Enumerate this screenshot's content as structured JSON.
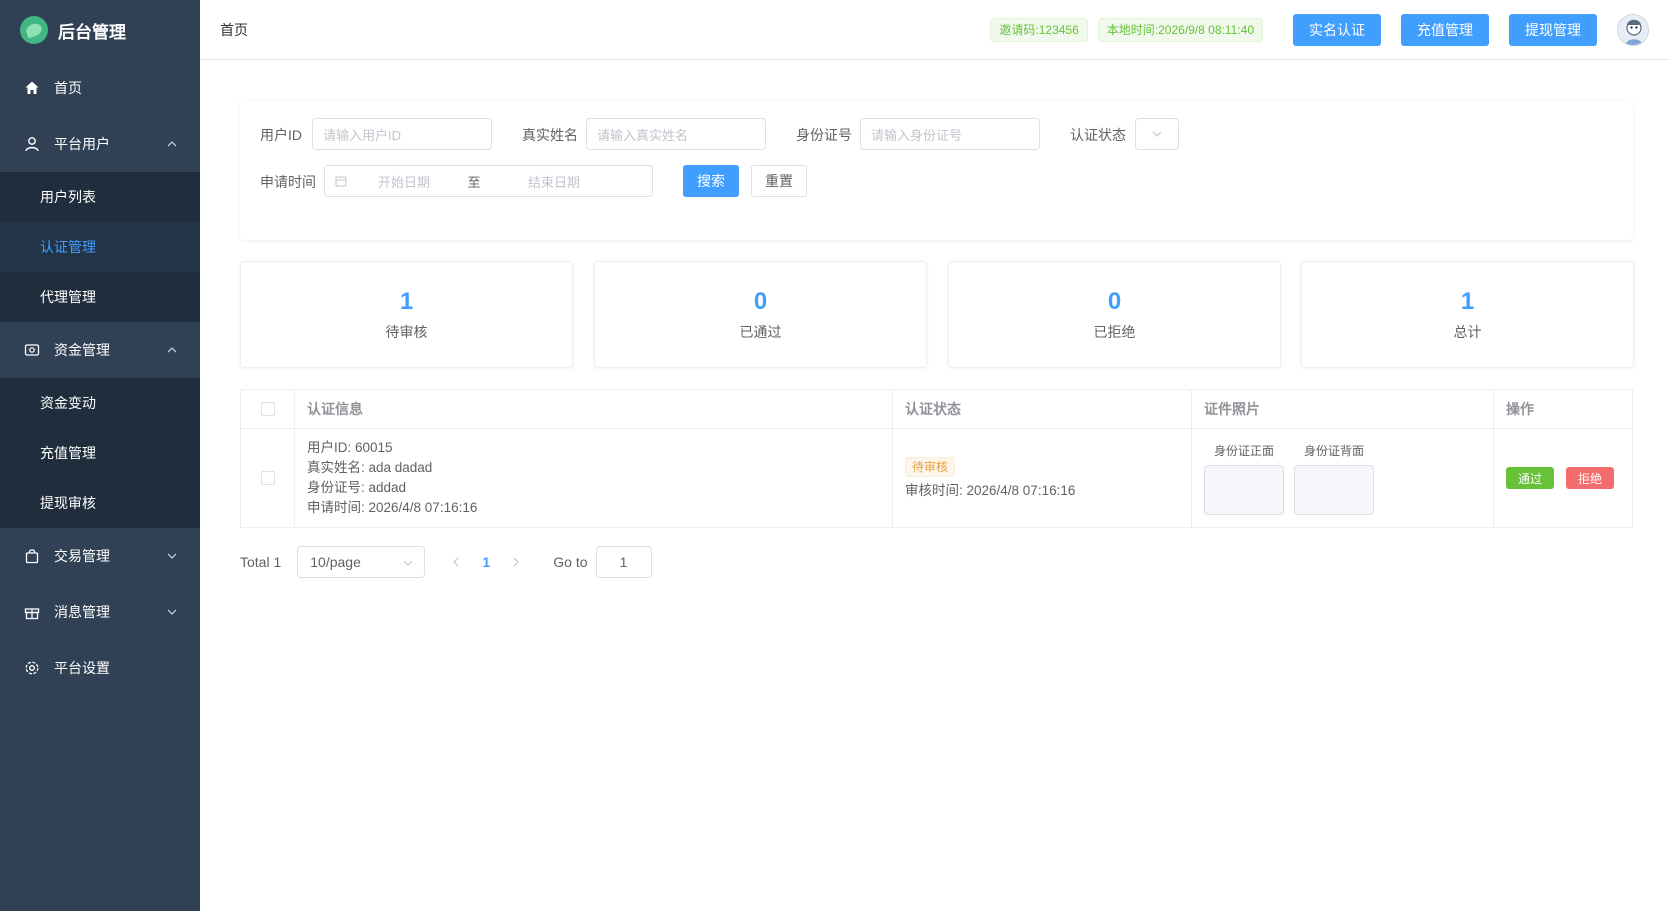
{
  "sidebar": {
    "title": "后台管理",
    "menu": {
      "home": "首页",
      "platform_users": "平台用户",
      "user_list": "用户列表",
      "auth_manage": "认证管理",
      "agent_manage": "代理管理",
      "funds_manage": "资金管理",
      "funds_change": "资金变动",
      "recharge_manage": "充值管理",
      "withdraw_review": "提现审核",
      "trade_manage": "交易管理",
      "message_manage": "消息管理",
      "platform_settings": "平台设置"
    }
  },
  "header": {
    "breadcrumb": "首页",
    "invite_code": "邀请码:123456",
    "local_time": "本地时间:2026/9/8 08:11:40",
    "btn_realname": "实名认证",
    "btn_recharge": "充值管理",
    "btn_withdraw": "提现管理"
  },
  "search": {
    "user_id_label": "用户ID",
    "user_id_placeholder": "请输入用户ID",
    "real_name_label": "真实姓名",
    "real_name_placeholder": "请输入真实姓名",
    "id_card_label": "身份证号",
    "id_card_placeholder": "请输入身份证号",
    "status_label": "认证状态",
    "apply_time_label": "申请时间",
    "start_placeholder": "开始日期",
    "range_sep": "至",
    "end_placeholder": "结束日期",
    "search_btn": "搜索",
    "reset_btn": "重置"
  },
  "stats": [
    {
      "value": "1",
      "label": "待审核"
    },
    {
      "value": "0",
      "label": "已通过"
    },
    {
      "value": "0",
      "label": "已拒绝"
    },
    {
      "value": "1",
      "label": "总计"
    }
  ],
  "table": {
    "headers": [
      "认证信息",
      "认证状态",
      "证件照片",
      "操作"
    ],
    "rows": [
      {
        "user_id": "用户ID: 60015",
        "real_name": "真实姓名: ada dadad",
        "id_card": "身份证号: addad",
        "apply_time": "申请时间: 2026/4/8 07:16:16",
        "status": "待审核",
        "review_time": "审核时间: 2026/4/8 07:16:16",
        "photo_front": "身份证正面",
        "photo_back": "身份证背面",
        "approve": "通过",
        "reject": "拒绝"
      }
    ]
  },
  "pagination": {
    "total": "Total 1",
    "page_size": "10/page",
    "current_page": "1",
    "goto_label": "Go to",
    "goto_value": "1"
  },
  "colors": {
    "sidebar_bg": "#304156",
    "primary": "#409eff",
    "success": "#67c23a",
    "danger": "#f56c6c",
    "warning": "#e6a23c"
  }
}
